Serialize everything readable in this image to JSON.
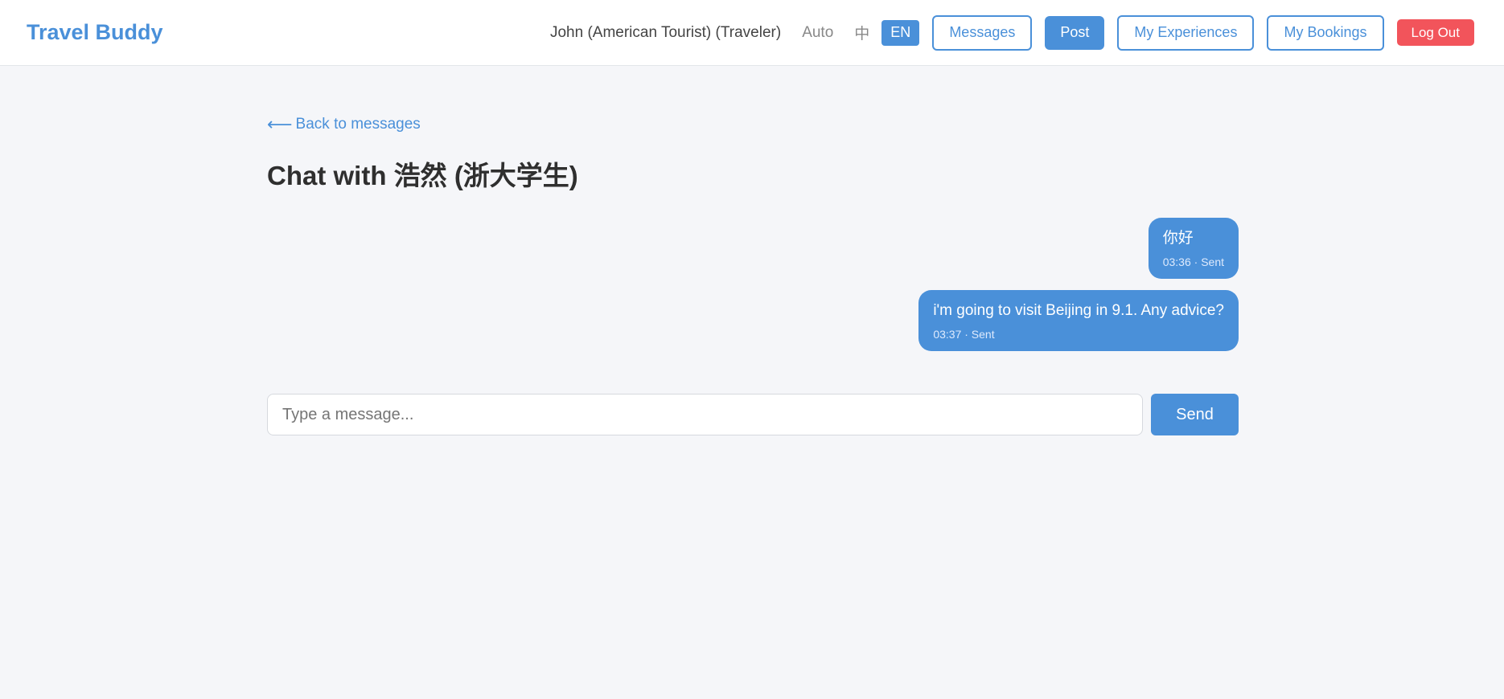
{
  "navbar": {
    "brand": "Travel Buddy",
    "user_label": "John (American Tourist) (Traveler)",
    "lang_auto": "Auto",
    "lang_zh": "中",
    "lang_en": "EN",
    "messages_label": "Messages",
    "post_label": "Post",
    "experiences_label": "My Experiences",
    "bookings_label": "My Bookings",
    "logout_label": "Log Out"
  },
  "chat": {
    "back_arrow": "⟵",
    "back_label": "Back to messages",
    "title": "Chat with 浩然 (浙大学生)",
    "messages": [
      {
        "text": "你好",
        "meta": "03:36 · Sent"
      },
      {
        "text": "i'm going to visit Beijing in 9.1. Any advice?",
        "meta": "03:37 · Sent"
      }
    ]
  },
  "composer": {
    "placeholder": "Type a message...",
    "value": "",
    "send_label": "Send"
  },
  "colors": {
    "accent": "#4a90d9",
    "danger": "#f2545b",
    "background": "#f5f6f9"
  }
}
